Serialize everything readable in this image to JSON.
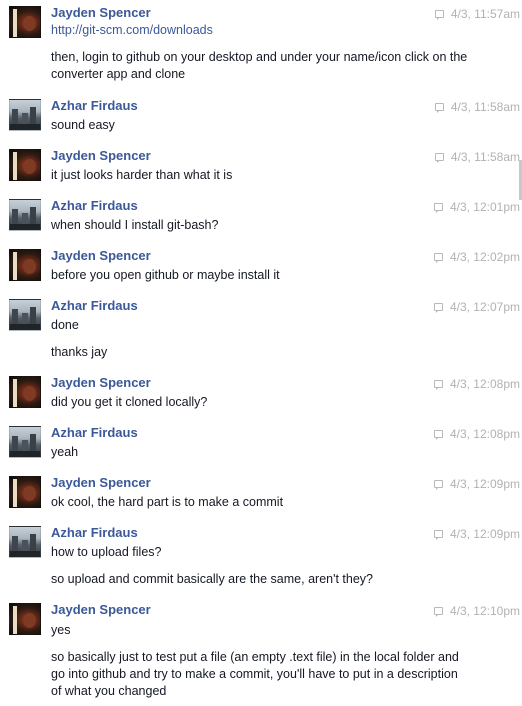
{
  "messages": [
    {
      "sender": "Jayden Spencer",
      "avatar": "jay",
      "time": "4/3, 11:57am",
      "lines": [
        "http://git-scm.com/downloads",
        "then, login to github on your desktop and under your name/icon click on the converter app and clone"
      ]
    },
    {
      "sender": "Azhar Firdaus",
      "avatar": "az",
      "time": "4/3, 11:58am",
      "lines": [
        "sound easy"
      ]
    },
    {
      "sender": "Jayden Spencer",
      "avatar": "jay",
      "time": "4/3, 11:58am",
      "lines": [
        "it just looks harder than what it is"
      ]
    },
    {
      "sender": "Azhar Firdaus",
      "avatar": "az",
      "time": "4/3, 12:01pm",
      "lines": [
        "when should I install git-bash?"
      ]
    },
    {
      "sender": "Jayden Spencer",
      "avatar": "jay",
      "time": "4/3, 12:02pm",
      "lines": [
        "before you open github or maybe install it"
      ]
    },
    {
      "sender": "Azhar Firdaus",
      "avatar": "az",
      "time": "4/3, 12:07pm",
      "lines": [
        "done",
        "thanks jay"
      ]
    },
    {
      "sender": "Jayden Spencer",
      "avatar": "jay",
      "time": "4/3, 12:08pm",
      "lines": [
        "did you get it cloned locally?"
      ]
    },
    {
      "sender": "Azhar Firdaus",
      "avatar": "az",
      "time": "4/3, 12:08pm",
      "lines": [
        "yeah"
      ]
    },
    {
      "sender": "Jayden Spencer",
      "avatar": "jay",
      "time": "4/3, 12:09pm",
      "lines": [
        "ok cool, the hard part is to make a commit"
      ]
    },
    {
      "sender": "Azhar Firdaus",
      "avatar": "az",
      "time": "4/3, 12:09pm",
      "lines": [
        "how to upload files?",
        "so upload and commit basically are the same, aren't they?"
      ]
    },
    {
      "sender": "Jayden Spencer",
      "avatar": "jay",
      "time": "4/3, 12:10pm",
      "lines": [
        "yes",
        "so basically just to test put a file (an empty .text file) in the  local folder and go into github and try to make a commit, you'll have to put in a description of what you changed"
      ]
    }
  ]
}
